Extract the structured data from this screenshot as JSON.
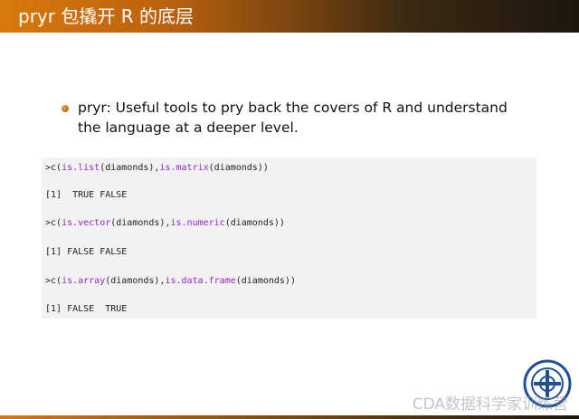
{
  "slide": {
    "title": "pryr 包撬开 R 的底层"
  },
  "bullet": {
    "text": "pryr: Useful tools to pry back the covers of R and understand the language at a deeper level."
  },
  "code": {
    "lines": [
      {
        "prefix": ">c(",
        "f1": "is.list",
        "arg1": "(diamonds),",
        "f2": "is.matrix",
        "arg2": "(diamonds))"
      },
      {
        "output": "[1]  TRUE FALSE"
      },
      {
        "prefix": ">c(",
        "f1": "is.vector",
        "arg1": "(diamonds),",
        "f2": "is.numeric",
        "arg2": "(diamonds))"
      },
      {
        "output": "[1] FALSE FALSE"
      },
      {
        "prefix": ">c(",
        "f1": "is.array",
        "arg1": "(diamonds),",
        "f2": "is.data.frame",
        "arg2": "(diamonds))"
      },
      {
        "output": "[1] FALSE  TRUE"
      }
    ]
  },
  "watermark": {
    "text": "CDA数据科学家训练营"
  },
  "colors": {
    "accent": "#d9790d",
    "function": "#9a23c4"
  }
}
